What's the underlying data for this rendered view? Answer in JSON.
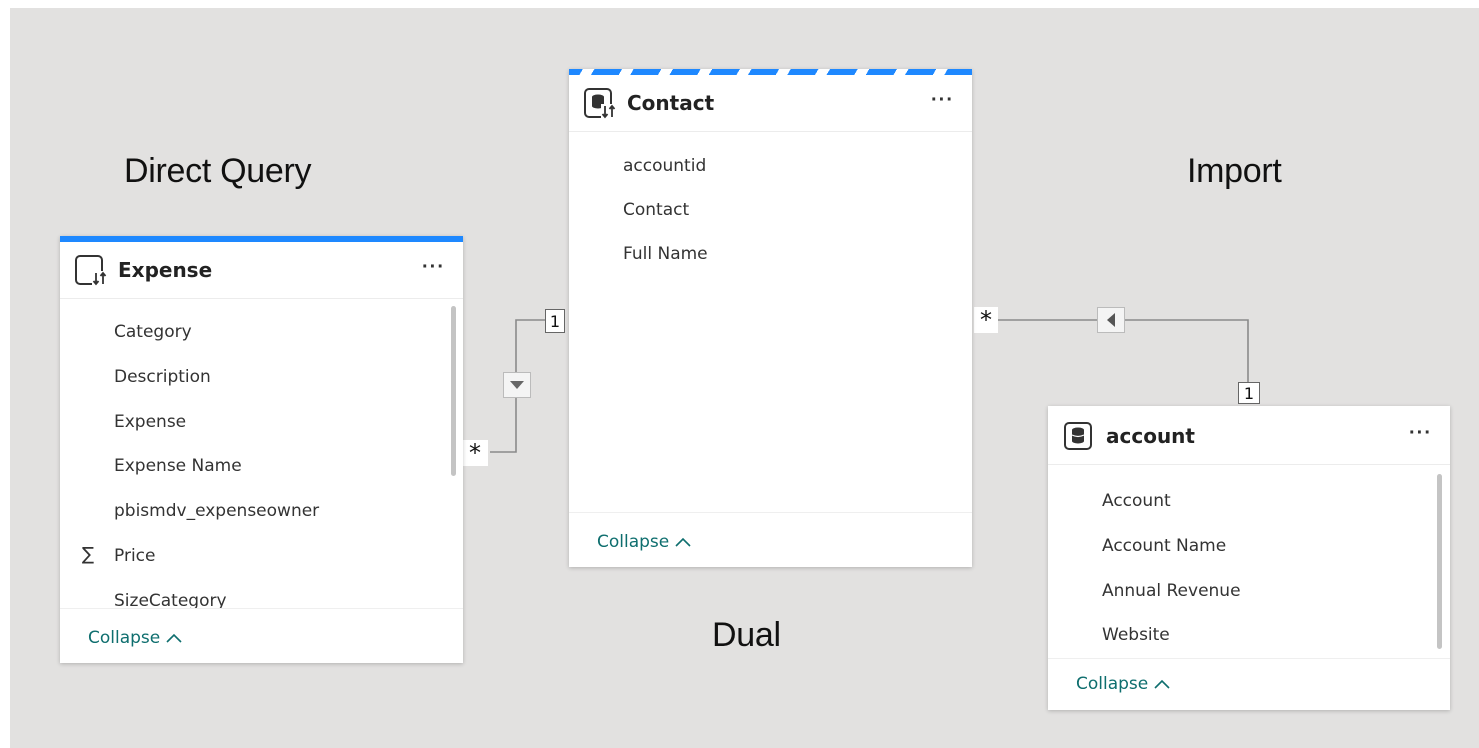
{
  "labels": {
    "direct_query": "Direct Query",
    "import": "Import",
    "dual": "Dual"
  },
  "tables": {
    "expense": {
      "title": "Expense",
      "more": "···",
      "icon": "directquery-table-icon",
      "fields": [
        "Category",
        "Description",
        "Expense",
        "Expense Name",
        "pbismdv_expenseowner",
        "Price",
        "SizeCategory"
      ],
      "sigma_field": "Price",
      "collapse": "Collapse"
    },
    "contact": {
      "title": "Contact",
      "more": "···",
      "icon": "dual-table-icon",
      "fields": [
        "accountid",
        "Contact",
        "Full Name"
      ],
      "collapse": "Collapse"
    },
    "account": {
      "title": "account",
      "more": "···",
      "icon": "import-table-icon",
      "fields": [
        "Account",
        "Account Name",
        "Annual Revenue",
        "Website"
      ],
      "collapse": "Collapse"
    }
  },
  "relationships": {
    "expense_contact": {
      "one": "1",
      "many": "*"
    },
    "contact_account": {
      "one": "1",
      "many": "*"
    }
  },
  "colors": {
    "accent": "#1e88ff",
    "canvas": "#e2e1e0",
    "link": "#0e6e6e"
  }
}
